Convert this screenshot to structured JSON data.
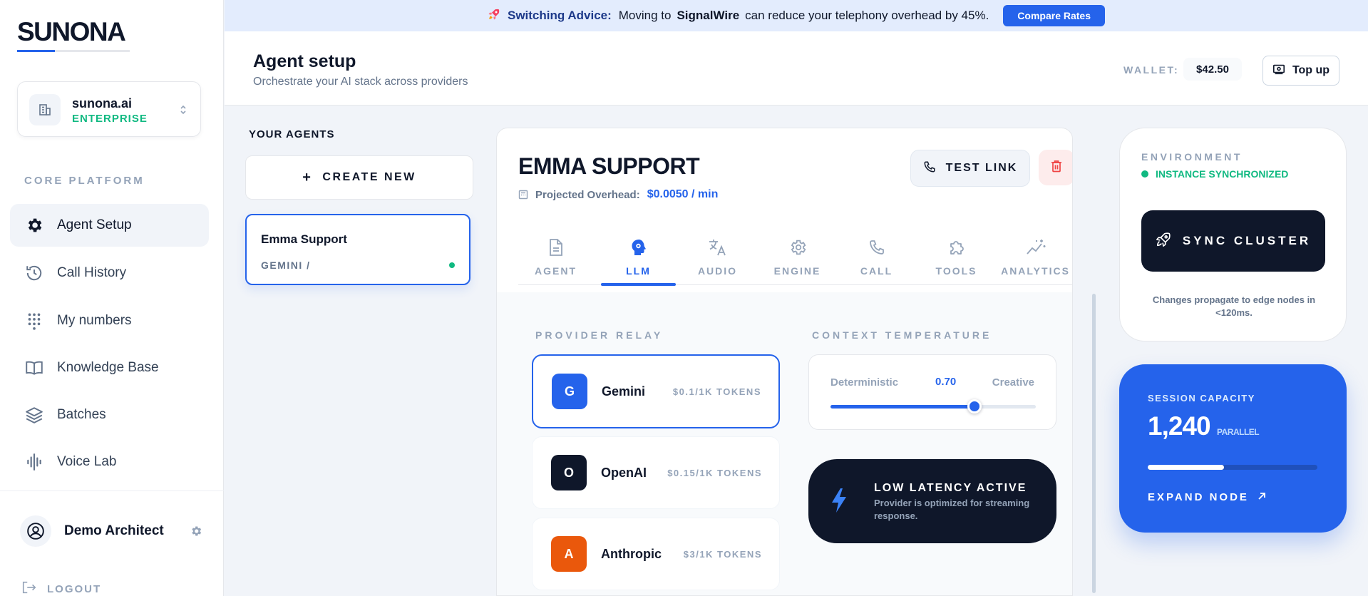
{
  "sidebar": {
    "logo": "SUNONA",
    "org": {
      "name": "sunona.ai",
      "plan": "ENTERPRISE"
    },
    "section_label": "CORE PLATFORM",
    "nav": [
      {
        "label": "Agent Setup",
        "icon": "gear-icon",
        "active": true
      },
      {
        "label": "Call History",
        "icon": "history-icon",
        "active": false
      },
      {
        "label": "My numbers",
        "icon": "dialpad-icon",
        "active": false
      },
      {
        "label": "Knowledge Base",
        "icon": "book-icon",
        "active": false
      },
      {
        "label": "Batches",
        "icon": "layers-icon",
        "active": false
      },
      {
        "label": "Voice Lab",
        "icon": "waveform-icon",
        "active": false
      }
    ],
    "user": {
      "name": "Demo Architect"
    },
    "logout_label": "LOGOUT"
  },
  "banner": {
    "icon": "rocket-icon",
    "lead": "Switching Advice:",
    "text_before": "Moving to",
    "brand": "SignalWire",
    "text_after": "can reduce your telephony overhead by 45%.",
    "button_label": "Compare Rates"
  },
  "header": {
    "title": "Agent setup",
    "subtitle": "Orchestrate your AI stack across providers",
    "wallet_label": "WALLET:",
    "wallet_value": "$42.50",
    "topup_label": "Top up"
  },
  "agents": {
    "section_label": "YOUR AGENTS",
    "create_label": "CREATE NEW",
    "items": [
      {
        "name": "Emma Support",
        "meta": "GEMINI /",
        "status": "online",
        "selected": true
      }
    ]
  },
  "agent_panel": {
    "title": "EMMA SUPPORT",
    "overhead_label": "Projected Overhead:",
    "overhead_value": "$0.0050 / min",
    "test_link_label": "TEST LINK",
    "tabs": [
      {
        "label": "AGENT",
        "icon": "document-icon",
        "active": false
      },
      {
        "label": "LLM",
        "icon": "brain-icon",
        "active": true
      },
      {
        "label": "AUDIO",
        "icon": "translate-icon",
        "active": false
      },
      {
        "label": "ENGINE",
        "icon": "gear-icon",
        "active": false
      },
      {
        "label": "CALL",
        "icon": "phone-icon",
        "active": false
      },
      {
        "label": "TOOLS",
        "icon": "puzzle-icon",
        "active": false
      },
      {
        "label": "ANALYTICS",
        "icon": "sparkline-icon",
        "active": false
      }
    ],
    "provider_relay": {
      "label": "PROVIDER RELAY",
      "providers": [
        {
          "letter": "G",
          "name": "Gemini",
          "price": "$0.1/1K TOKENS",
          "color": "#2563eb",
          "selected": true
        },
        {
          "letter": "O",
          "name": "OpenAI",
          "price": "$0.15/1K TOKENS",
          "color": "#0f172a",
          "selected": false
        },
        {
          "letter": "A",
          "name": "Anthropic",
          "price": "$3/1K TOKENS",
          "color": "#ea580c",
          "selected": false
        }
      ]
    },
    "context_temperature": {
      "label": "CONTEXT TEMPERATURE",
      "left_label": "Deterministic",
      "value": "0.70",
      "right_label": "Creative",
      "fraction": 0.7
    },
    "latency": {
      "title": "LOW LATENCY ACTIVE",
      "description": "Provider is optimized for streaming response."
    }
  },
  "environment": {
    "label": "ENVIRONMENT",
    "status": "INSTANCE SYNCHRONIZED",
    "sync_label": "SYNC CLUSTER",
    "note": "Changes propagate to edge nodes in <120ms."
  },
  "capacity": {
    "label": "SESSION CAPACITY",
    "value": "1,240",
    "unit": "PARALLEL",
    "fill_fraction": 0.45,
    "expand_label": "EXPAND NODE"
  },
  "colors": {
    "accent": "#2563eb",
    "dark": "#0f172a",
    "success": "#10b981",
    "danger": "#ef4444"
  }
}
